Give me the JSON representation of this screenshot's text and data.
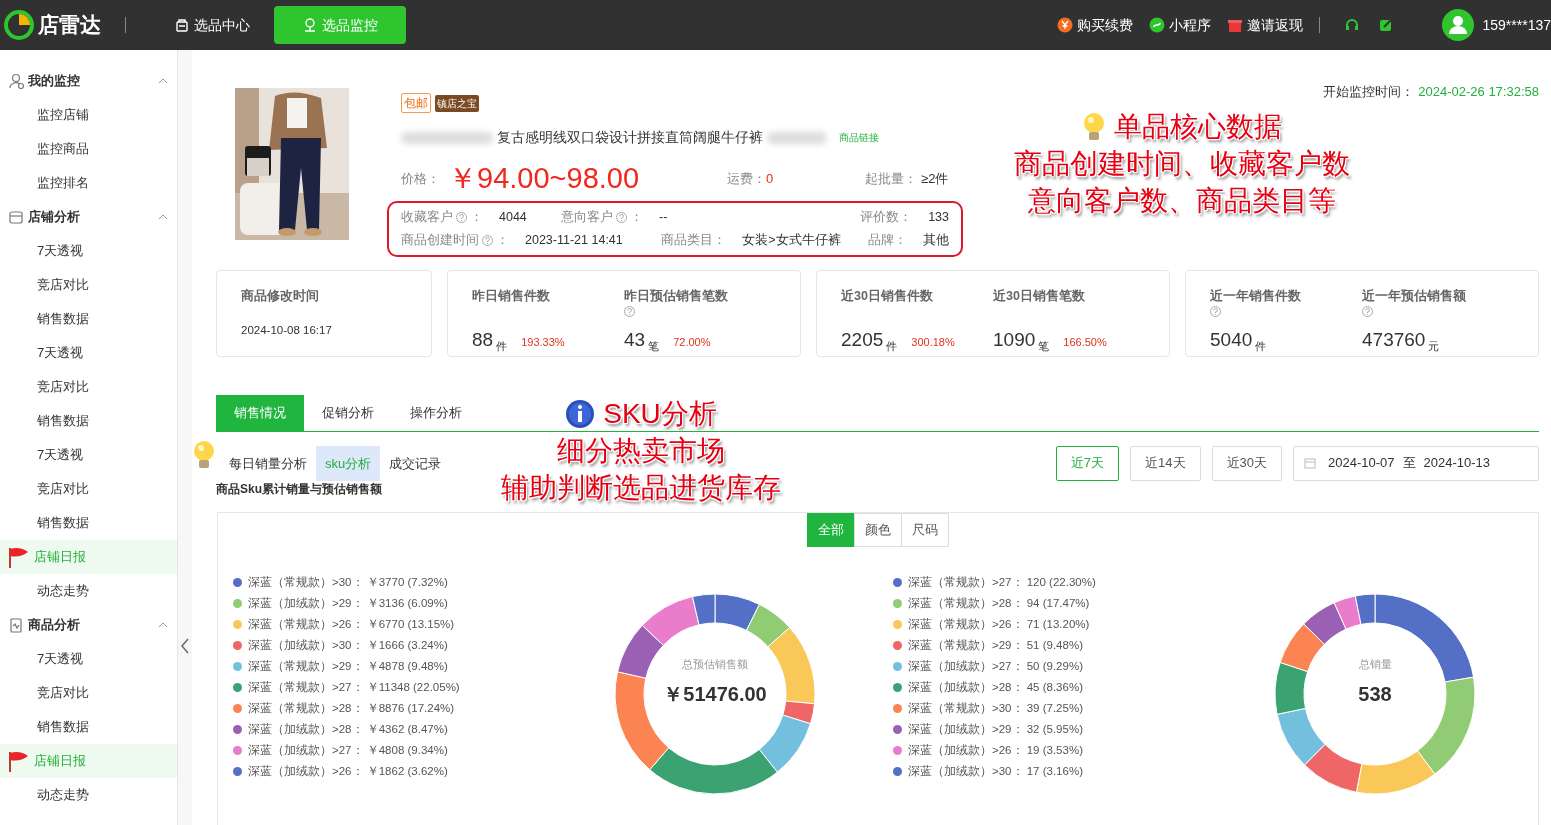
{
  "topbar": {
    "logo": "店雷达",
    "nav": [
      {
        "label": "选品中心",
        "selected": false
      },
      {
        "label": "选品监控",
        "selected": true
      }
    ],
    "actions": [
      {
        "label": "购买续费",
        "kind": "coin"
      },
      {
        "label": "小程序",
        "kind": "mini"
      },
      {
        "label": "邀请返现",
        "kind": "gift"
      }
    ],
    "user": "159****137"
  },
  "sidebar": {
    "groups": [
      {
        "label": "我的监控",
        "kind": "user",
        "expanded": true,
        "items": [
          {
            "label": "监控店铺",
            "selected": false
          },
          {
            "label": "监控商品",
            "selected": false
          },
          {
            "label": "监控排名",
            "selected": false
          }
        ]
      },
      {
        "label": "店铺分析",
        "kind": "shop",
        "expanded": true,
        "items": [
          {
            "label": "7天透视",
            "selected": false
          },
          {
            "label": "竞店对比",
            "selected": false
          },
          {
            "label": "销售数据",
            "selected": false
          },
          {
            "label": "7天透视",
            "selected": false
          },
          {
            "label": "竞店对比",
            "selected": false
          },
          {
            "label": "销售数据",
            "selected": false
          },
          {
            "label": "7天透视",
            "selected": false
          },
          {
            "label": "竞店对比",
            "selected": false
          },
          {
            "label": "销售数据",
            "selected": false
          },
          {
            "label": "店铺日报",
            "selected": true
          },
          {
            "label": "动态走势",
            "selected": false
          }
        ]
      },
      {
        "label": "商品分析",
        "kind": "goods",
        "expanded": true,
        "items": [
          {
            "label": "7天透视",
            "selected": false
          },
          {
            "label": "竞店对比",
            "selected": false
          },
          {
            "label": "销售数据",
            "selected": false
          },
          {
            "label": "店铺日报",
            "selected": true
          },
          {
            "label": "动态走势",
            "selected": false
          }
        ]
      }
    ]
  },
  "product": {
    "tags": [
      {
        "label": "包邮",
        "kind": "outline"
      },
      {
        "label": "镇店之宝",
        "kind": "badge"
      }
    ],
    "title": "复古感明线双口袋设计拼接直筒阔腿牛仔裤",
    "link": "商品链接",
    "price_label": "价格：",
    "price": "￥94.00~98.00",
    "freight_label": "运费：",
    "freight": "0",
    "moq_label": "起批量：",
    "moq": "≥2件",
    "metric_rows": [
      [
        {
          "label": "收藏客户",
          "help": true,
          "sep": "：",
          "value": "4044"
        },
        {
          "label": "意向客户",
          "help": true,
          "sep": "：",
          "value": "--"
        },
        {
          "label": "评价数：",
          "help": false,
          "value": "133"
        }
      ],
      [
        {
          "label": "商品创建时间",
          "help": true,
          "sep": "：",
          "value": "2023-11-21 14:41"
        },
        {
          "label": "商品类目：",
          "help": false,
          "value": "女装>女式牛仔裤"
        },
        {
          "label": "品牌：",
          "help": false,
          "value": "其他"
        }
      ]
    ]
  },
  "monitor_start": {
    "label": "开始监控时间：",
    "value": "2024-02-26 17:32:58"
  },
  "annotations": [
    {
      "kind": "bulb",
      "lines": [
        "单品核心数据",
        "商品创建时间、收藏客户数",
        "意向客户数、商品类目等"
      ]
    },
    {
      "kind": "info",
      "lines": [
        "SKU分析",
        "细分热卖市场",
        "辅助判断选品进货库存"
      ]
    }
  ],
  "stat_cards": [
    {
      "kind": "text",
      "title": "商品修改时间",
      "value": "2024-10-08 16:17"
    },
    {
      "kind": "stats",
      "stats": [
        {
          "label": "昨日销售件数",
          "help": false,
          "value": "88",
          "unit": "件",
          "change": "193.33%"
        },
        {
          "label": "昨日预估销售笔数",
          "help": true,
          "value": "43",
          "unit": "笔",
          "change": "72.00%"
        }
      ]
    },
    {
      "kind": "stats",
      "stats": [
        {
          "label": "近30日销售件数",
          "help": false,
          "value": "2205",
          "unit": "件",
          "change": "300.18%"
        },
        {
          "label": "近30日销售笔数",
          "help": false,
          "value": "1090",
          "unit": "笔",
          "change": "166.50%"
        }
      ]
    },
    {
      "kind": "stats",
      "stats": [
        {
          "label": "近一年销售件数",
          "help": true,
          "value": "5040",
          "unit": "件"
        },
        {
          "label": "近一年预估销售额",
          "help": true,
          "value": "473760",
          "unit": "元"
        }
      ]
    }
  ],
  "tabs": [
    {
      "label": "销售情况",
      "selected": true
    },
    {
      "label": "促销分析",
      "selected": false
    },
    {
      "label": "操作分析",
      "selected": false
    }
  ],
  "subtabs": [
    {
      "label": "每日销量分析",
      "selected": false
    },
    {
      "label": "sku分析",
      "selected": true
    },
    {
      "label": "成交记录",
      "selected": false
    }
  ],
  "subtitle": "商品Sku累计销量与预估销售额",
  "ranges": [
    {
      "label": "近7天",
      "selected": true
    },
    {
      "label": "近14天",
      "selected": false
    },
    {
      "label": "近30天",
      "selected": false
    }
  ],
  "date_range": {
    "start": "2024-10-07",
    "sep": "至",
    "end": "2024-10-13"
  },
  "filters": [
    {
      "label": "全部",
      "selected": true
    },
    {
      "label": "颜色",
      "selected": false
    },
    {
      "label": "尺码",
      "selected": false
    }
  ],
  "charts": [
    {
      "center_label": "总预估销售额",
      "center_value": "￥51476.00",
      "slices": [
        {
          "color": "#5470c6"
        },
        {
          "color": "#91cc75"
        },
        {
          "color": "#fac858"
        },
        {
          "color": "#ee6666"
        },
        {
          "color": "#73c0de"
        },
        {
          "color": "#3ba272"
        },
        {
          "color": "#fc8452"
        },
        {
          "color": "#9a60b4"
        },
        {
          "color": "#ea7ccc"
        },
        {
          "color": "#5470c6"
        }
      ],
      "chart_data": {
        "type": "donut",
        "legend": "left",
        "categories": [
          "深蓝（常规款）>30",
          "深蓝（加绒款）>29",
          "深蓝（常规款）>26",
          "深蓝（加绒款）>30",
          "深蓝（常规款）>29",
          "深蓝（常规款）>27",
          "深蓝（常规款）>28",
          "深蓝（加绒款）>28",
          "深蓝（加绒款）>27",
          "深蓝（加绒款）>26"
        ],
        "values": [
          3770,
          3136,
          6770,
          1666,
          4878,
          11348,
          8876,
          4362,
          4808,
          1862
        ],
        "value_labels": [
          "： ￥3770 (7.32%)",
          "： ￥3136 (6.09%)",
          "： ￥6770 (13.15%)",
          "： ￥1666 (3.24%)",
          "： ￥4878 (9.48%)",
          "： ￥11348 (22.05%)",
          "： ￥8876 (17.24%)",
          "： ￥4362 (8.47%)",
          "： ￥4808 (9.34%)",
          "： ￥1862 (3.62%)"
        ]
      }
    },
    {
      "center_label": "总销量",
      "center_value": "538",
      "slices": [
        {
          "color": "#5470c6"
        },
        {
          "color": "#91cc75"
        },
        {
          "color": "#fac858"
        },
        {
          "color": "#ee6666"
        },
        {
          "color": "#73c0de"
        },
        {
          "color": "#3ba272"
        },
        {
          "color": "#fc8452"
        },
        {
          "color": "#9a60b4"
        },
        {
          "color": "#ea7ccc"
        },
        {
          "color": "#5470c6"
        }
      ],
      "chart_data": {
        "type": "donut",
        "legend": "left",
        "categories": [
          "深蓝（常规款）>27",
          "深蓝（常规款）>28",
          "深蓝（常规款）>26",
          "深蓝（常规款）>29",
          "深蓝（加绒款）>27",
          "深蓝（加绒款）>28",
          "深蓝（常规款）>30",
          "深蓝（加绒款）>29",
          "深蓝（加绒款）>26",
          "深蓝（加绒款）>30"
        ],
        "values": [
          120,
          94,
          71,
          51,
          50,
          45,
          39,
          32,
          19,
          17
        ],
        "value_labels": [
          "： 120 (22.30%)",
          "： 94 (17.47%)",
          "： 71 (13.20%)",
          "： 51 (9.48%)",
          "： 50 (9.29%)",
          "： 45 (8.36%)",
          "： 39 (7.25%)",
          "： 32 (5.95%)",
          "： 19 (3.53%)",
          "： 17 (3.16%)"
        ]
      }
    }
  ]
}
